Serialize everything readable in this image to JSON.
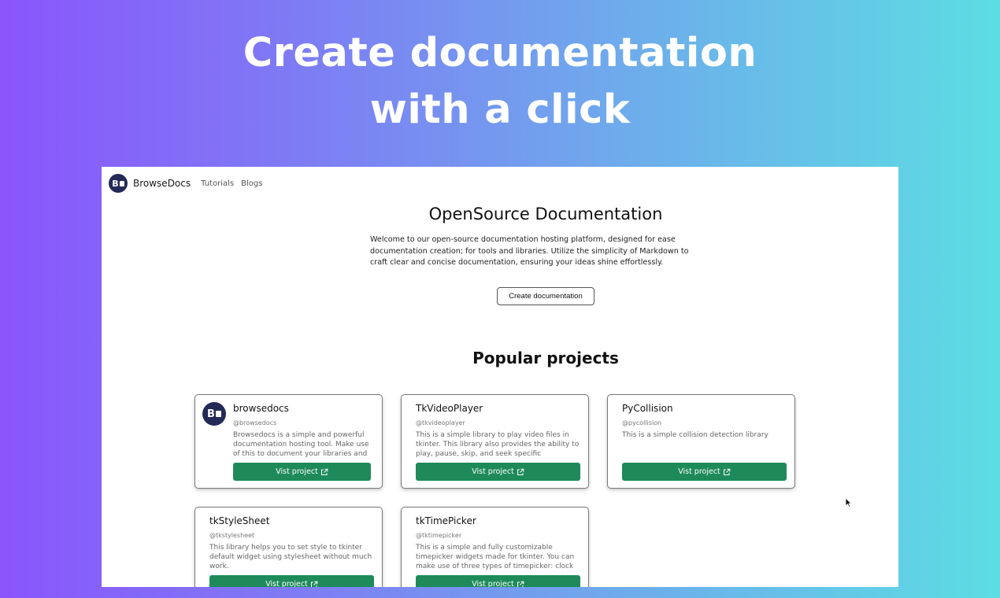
{
  "hero": {
    "line1": "Create documentation",
    "line2": "with a click"
  },
  "nav": {
    "brand": "BrowseDocs",
    "links": [
      "Tutorials",
      "Blogs"
    ]
  },
  "main": {
    "heading": "OpenSource Documentation",
    "intro": "Welcome to our open-source documentation hosting platform, designed for ease documentation creation; for tools and libraries. Utilize the simplicity of Markdown to craft clear and concise documentation, ensuring your ideas shine effortlessly.",
    "create_button": "Create documentation",
    "popular_heading": "Popular projects"
  },
  "projects": [
    {
      "name": "browsedocs",
      "handle": "@browsedocs",
      "description": "Browsedocs is a simple and powerful documentation hosting tool. Make use of this to document your libraries and tools.",
      "button": "Vist project"
    },
    {
      "name": "TkVideoPlayer",
      "handle": "@tkvideoplayer",
      "description": "This is a simple library to play video files in tkinter. This library also provides the ability to play, pause, skip, and seek specific timestamps.",
      "button": "Vist project"
    },
    {
      "name": "PyCollision",
      "handle": "@pycollision",
      "description": "This is a simple collision detection library",
      "button": "Vist project"
    },
    {
      "name": "tkStyleSheet",
      "handle": "@tkstylesheet",
      "description": "This library helps you to set style to tkinter default widget using stylesheet without much work.",
      "button": "Vist project"
    },
    {
      "name": "tkTimePicker",
      "handle": "@tktimepicker",
      "description": "This is a simple and fully customizable timepicker widgets made for tkinter. You can make use of three types of timepicker: clock timepicker, old-spin timepicker and modern timepicker.",
      "button": "Vist project"
    }
  ],
  "colors": {
    "gradient_start": "#8a55fc",
    "gradient_end": "#5cdde3",
    "brand_dark": "#242a57",
    "button_green": "#1e8a5a"
  },
  "icons": {
    "external_link": "external-link-icon",
    "logo": "browsedocs-logo-icon",
    "cursor": "mouse-cursor-icon"
  }
}
